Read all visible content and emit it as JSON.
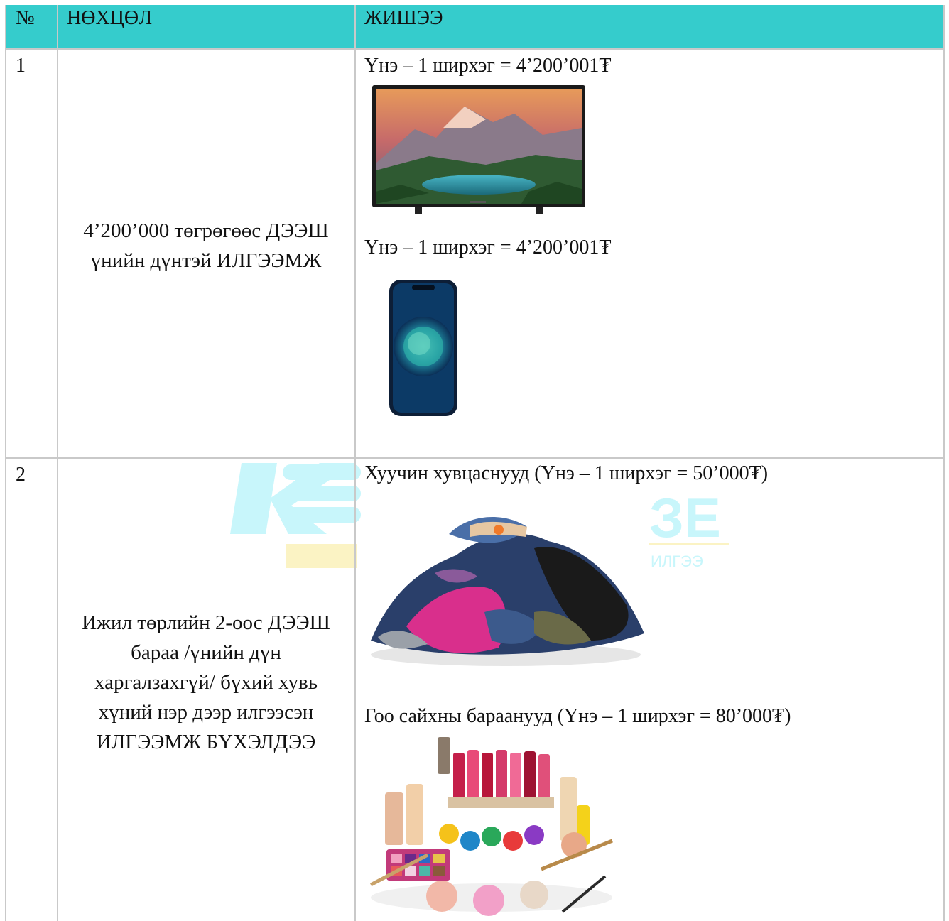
{
  "table": {
    "headers": {
      "num": "№",
      "condition": "НӨХЦӨЛ",
      "example": "ЖИШЭЭ"
    },
    "rows": [
      {
        "num": "1",
        "condition_line1": "4’200’000 төгрөгөөс ДЭЭШ",
        "condition_line2": "үнийн дүнтэй ИЛГЭЭМЖ",
        "examples": [
          {
            "caption": "Үнэ – 1 ширхэг = 4’200’001₮",
            "image": "television-image"
          },
          {
            "caption": "Үнэ – 1 ширхэг = 4’200’001₮",
            "image": "smartphone-image"
          }
        ]
      },
      {
        "num": "2",
        "condition_line1": "Ижил төрлийн 2-оос ДЭЭШ",
        "condition_line2": "бараа /үнийн дүн",
        "condition_line3": "харгалзахгүй/ бүхий хувь",
        "condition_line4": "хүний нэр дээр илгээсэн",
        "condition_line5": "ИЛГЭЭМЖ БҮХЭЛДЭЭ",
        "examples": [
          {
            "caption": "Хуучин хувцаснууд (Үнэ – 1 ширхэг = 50’000₮)",
            "image": "used-clothes-image"
          },
          {
            "caption": "Гоо сайхны бараанууд  (Үнэ – 1 ширхэг = 80’000₮)",
            "image": "cosmetics-image"
          }
        ]
      }
    ]
  },
  "colors": {
    "header_background": "#35cccc",
    "grid_line": "#c9c9c9",
    "watermark_cyan": "#c8f6fb",
    "watermark_yellow": "#fbf3c4"
  }
}
